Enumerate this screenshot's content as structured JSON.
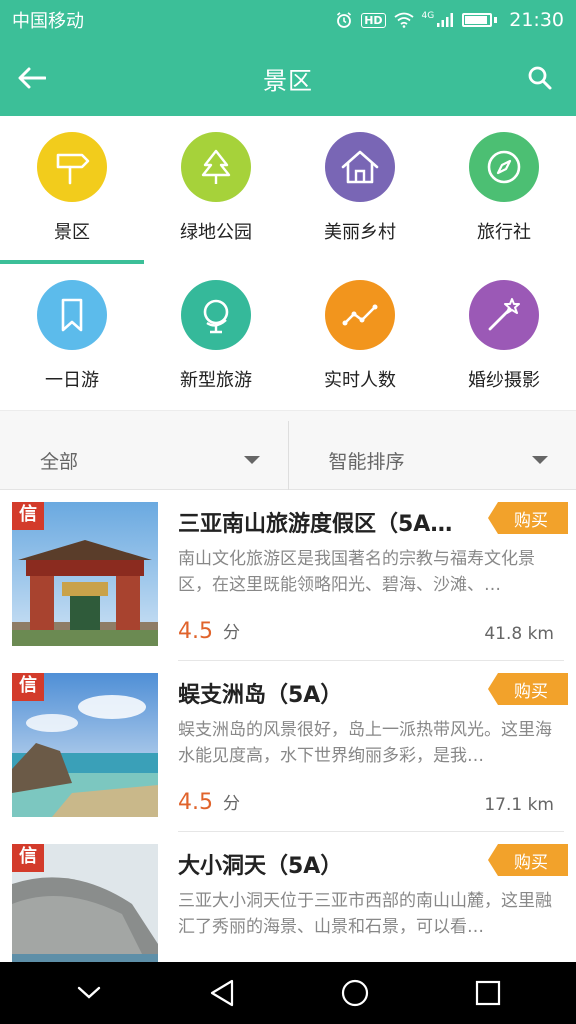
{
  "status_bar": {
    "carrier": "中国移动",
    "hd": "HD",
    "signal": "4G",
    "time": "21:30"
  },
  "header": {
    "title": "景区"
  },
  "categories": [
    {
      "label": "景区",
      "icon": "signpost-icon",
      "color": "#f2cc1c",
      "selected": true
    },
    {
      "label": "绿地公园",
      "icon": "tree-icon",
      "color": "#a6d23a",
      "selected": false
    },
    {
      "label": "美丽乡村",
      "icon": "house-icon",
      "color": "#7966b5",
      "selected": false
    },
    {
      "label": "旅行社",
      "icon": "compass-icon",
      "color": "#4cbf73",
      "selected": false
    },
    {
      "label": "一日游",
      "icon": "bookmark-icon",
      "color": "#5cbbeb",
      "selected": false
    },
    {
      "label": "新型旅游",
      "icon": "globe-icon",
      "color": "#35b99a",
      "selected": false
    },
    {
      "label": "实时人数",
      "icon": "trend-chart-icon",
      "color": "#f2951d",
      "selected": false
    },
    {
      "label": "婚纱摄影",
      "icon": "magic-wand-icon",
      "color": "#9b59b6",
      "selected": false
    }
  ],
  "filters": {
    "scope": "全部",
    "sort": "智能排序"
  },
  "list": [
    {
      "badge": "信",
      "title": "三亚南山旅游度假区（5A…",
      "buy_label": "购买",
      "description": "南山文化旅游区是我国著名的宗教与福寿文化景区，在这里既能领略阳光、碧海、沙滩、…",
      "rating": "4.5",
      "rating_unit": "分",
      "distance": "41.8 km"
    },
    {
      "badge": "信",
      "title": "蜈支洲岛（5A）",
      "buy_label": "购买",
      "description": "蜈支洲岛的风景很好，岛上一派热带风光。这里海水能见度高，水下世界绚丽多彩，是我…",
      "rating": "4.5",
      "rating_unit": "分",
      "distance": "17.1 km"
    },
    {
      "badge": "信",
      "title": "大小洞天（5A）",
      "buy_label": "购买",
      "description": "三亚大小洞天位于三亚市西部的南山山麓，这里融汇了秀丽的海景、山景和石景，可以看…",
      "rating": "",
      "rating_unit": "",
      "distance": ""
    }
  ],
  "accent_color": "#3cbf98",
  "buy_color": "#f2a22b",
  "rating_color": "#e0632b"
}
